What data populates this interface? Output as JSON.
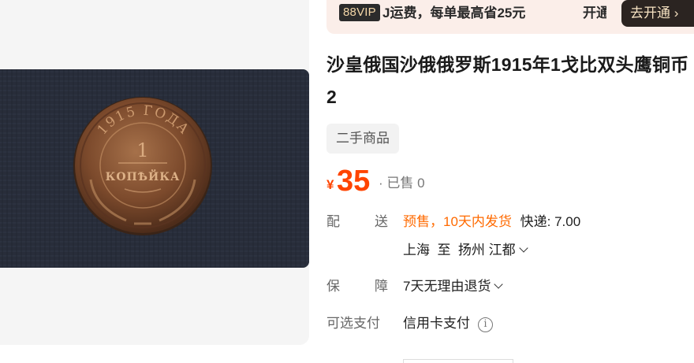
{
  "vip": {
    "badge": "88VIP",
    "text": "J运费，每单最高省25元",
    "open_text": "开通",
    "button_label": "去开通",
    "button_arrow": "›"
  },
  "product": {
    "title": "沙皇俄国沙俄俄罗斯1915年1戈比双头鹰铜币2",
    "tag": "二手商品",
    "currency": "¥",
    "price": "35",
    "sold": "· 已售 0"
  },
  "coin": {
    "year_text": "1915 ГОДА",
    "denomination": "1",
    "unit_text": "КОПѢЙКА"
  },
  "delivery": {
    "label_a": "配",
    "label_b": "送",
    "presale": "预售，10天内发货",
    "shipping": "快递: 7.00",
    "route": "上海  至  扬州 江都"
  },
  "guarantee": {
    "label_a": "保",
    "label_b": "障",
    "value": "7天无理由退货"
  },
  "payment": {
    "label": "可选支付",
    "value": "信用卡支付",
    "info_icon": "i"
  },
  "icons": {
    "chevron": "chevron-down-icon",
    "info": "info-icon"
  },
  "colors": {
    "price": "#ff4400",
    "presale": "#ff6a00",
    "vip_bg": "#fbeee9",
    "vip_button": "#2b2421"
  }
}
